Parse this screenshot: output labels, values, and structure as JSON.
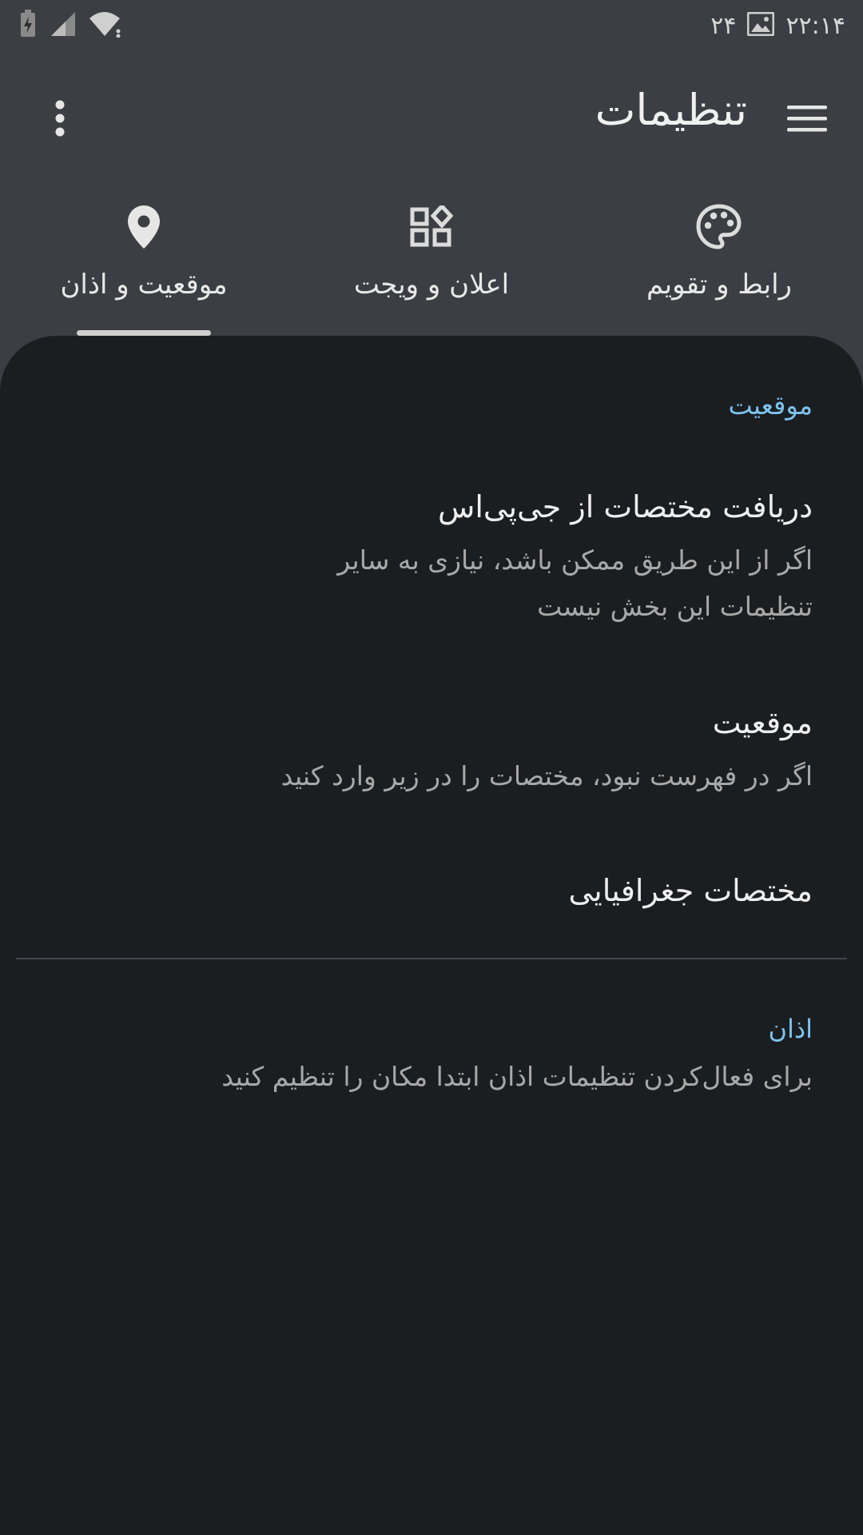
{
  "status_bar": {
    "time": "۲۲:۱۴",
    "notification_count": "۲۴"
  },
  "toolbar": {
    "title": "تنظیمات"
  },
  "tabs": [
    {
      "label": "رابط و تقویم",
      "icon": "palette-icon"
    },
    {
      "label": "اعلان و ویجت",
      "icon": "widgets-icon"
    },
    {
      "label": "موقعیت و اذان",
      "icon": "location-pin-icon",
      "selected": true
    }
  ],
  "location_section": {
    "header": "موقعیت",
    "gps": {
      "title": "دریافت مختصات از جی‌پی‌اس",
      "summary": "اگر از این طریق ممکن باشد، نیازی به سایر تنظیمات این بخش نیست"
    },
    "city": {
      "title": "موقعیت",
      "summary": "اگر در فهرست نبود، مختصات را در زیر وارد کنید"
    },
    "coordinates": {
      "title": "مختصات جغرافیایی"
    }
  },
  "athan_section": {
    "header": "اذان",
    "summary": "برای فعال‌کردن تنظیمات اذان ابتدا مکان را تنظیم کنید"
  },
  "colors": {
    "accent": "#7cc4f0",
    "background": "#1b1e21",
    "toolbar": "#3b3e42"
  }
}
